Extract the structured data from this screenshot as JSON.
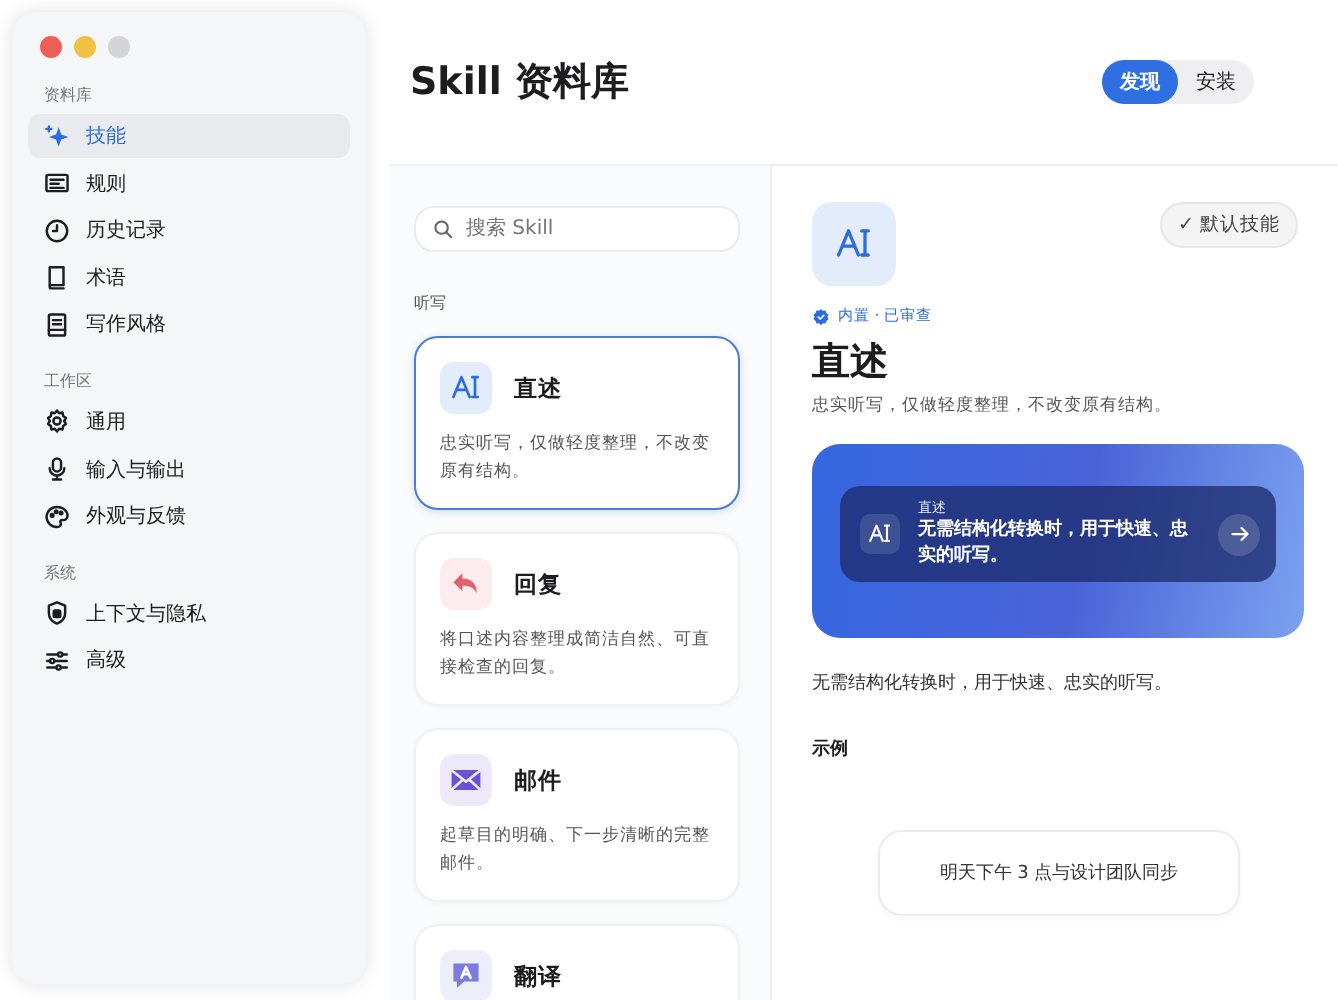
{
  "window": {
    "controls": [
      {
        "kind": "close"
      },
      {
        "kind": "minimize"
      },
      {
        "kind": "zoom"
      }
    ]
  },
  "sidebar": {
    "sections": [
      {
        "title": "资料库",
        "items": [
          {
            "label": "技能",
            "kind": "sparkle",
            "selected": true
          },
          {
            "label": "规则",
            "kind": "rules",
            "selected": false
          },
          {
            "label": "历史记录",
            "kind": "clock",
            "selected": false
          },
          {
            "label": "术语",
            "kind": "book",
            "selected": false
          },
          {
            "label": "写作风格",
            "kind": "doc",
            "selected": false
          }
        ]
      },
      {
        "title": "工作区",
        "items": [
          {
            "label": "通用",
            "kind": "gear",
            "selected": false
          },
          {
            "label": "输入与输出",
            "kind": "mic",
            "selected": false
          },
          {
            "label": "外观与反馈",
            "kind": "palette",
            "selected": false
          }
        ]
      },
      {
        "title": "系统",
        "items": [
          {
            "label": "上下文与隐私",
            "kind": "shield",
            "selected": false
          },
          {
            "label": "高级",
            "kind": "sliders",
            "selected": false
          }
        ]
      }
    ]
  },
  "header": {
    "title": "Skill 资料库",
    "tabs": [
      {
        "label": "发现",
        "selected": true
      },
      {
        "label": "安装",
        "selected": false
      }
    ]
  },
  "skill_list": {
    "search": {
      "placeholder": "搜索 Skill"
    },
    "section": "听写",
    "skills": [
      {
        "kind": "dictate",
        "title": "直述",
        "description": "忠实听写，仅做轻度整理，不改变原有结构。",
        "selected": true
      },
      {
        "kind": "reply",
        "title": "回复",
        "description": "将口述内容整理成简洁自然、可直接检查的回复。",
        "selected": false
      },
      {
        "kind": "mail",
        "title": "邮件",
        "description": "起草目的明确、下一步清晰的完整邮件。",
        "selected": false
      },
      {
        "kind": "translate",
        "title": "翻译",
        "selected": false
      }
    ]
  },
  "detail": {
    "kind": "dictate",
    "default_button": "✓ 默认技能",
    "meta": "内置 · 已审查",
    "title": "直述",
    "description": "忠实听写，仅做轻度整理，不改变原有结构。",
    "preview": {
      "label": "直述",
      "text": "无需结构化转换时，用于快速、忠实的听写。"
    },
    "usage": "无需结构化转换时，用于快速、忠实的听写。",
    "example_heading": "示例",
    "example": "明天下午 3 点与设计团队同步"
  }
}
